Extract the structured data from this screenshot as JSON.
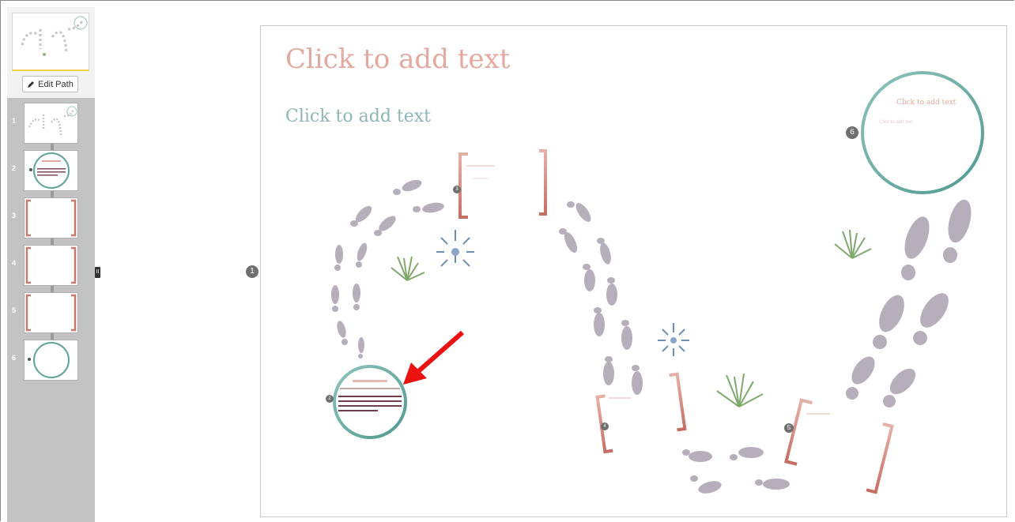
{
  "sidebar": {
    "edit_path_label": "Edit Path",
    "collapse_handle": "II",
    "steps": [
      {
        "number": "1",
        "kind": "overview"
      },
      {
        "number": "2",
        "kind": "circle"
      },
      {
        "number": "3",
        "kind": "bracket"
      },
      {
        "number": "4",
        "kind": "bracket"
      },
      {
        "number": "5",
        "kind": "bracket"
      },
      {
        "number": "6",
        "kind": "circle"
      }
    ]
  },
  "canvas": {
    "title_placeholder": "Click to add text",
    "subtitle_placeholder": "Click to add text",
    "path_badges": [
      "1",
      "2",
      "3",
      "4",
      "5",
      "6"
    ],
    "frame6_title": "Click to add text",
    "frame6_subtitle": "Click to add text"
  },
  "colors": {
    "title": "#e3a99f",
    "subtitle": "#8fb5b5",
    "circle_frame": "#5fa39a",
    "bracket_frame": "#c97a6e",
    "footprint": "#b7aebb",
    "annotation_arrow": "#ee1111"
  },
  "icons": [
    "pencil-icon",
    "footprint-icon",
    "grass-icon",
    "flower-icon",
    "arrow-icon"
  ]
}
